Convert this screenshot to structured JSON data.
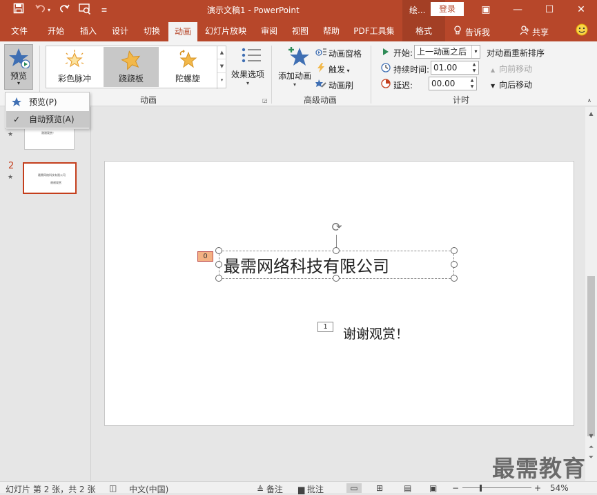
{
  "app": {
    "title": "演示文稿1  -  PowerPoint",
    "draw_label": "绘...",
    "login": "登录"
  },
  "quick_access": {
    "icons": [
      "save-icon",
      "undo-icon",
      "redo-icon",
      "start-from-beginning-icon",
      "customize-icon"
    ]
  },
  "window_controls": {
    "ribbon_display": "▣",
    "minimize": "—",
    "maximize": "☐",
    "close": "✕"
  },
  "tabs": [
    {
      "label": "文件"
    },
    {
      "label": "开始"
    },
    {
      "label": "插入"
    },
    {
      "label": "设计"
    },
    {
      "label": "切换"
    },
    {
      "label": "动画"
    },
    {
      "label": "幻灯片放映"
    },
    {
      "label": "审阅"
    },
    {
      "label": "视图"
    },
    {
      "label": "帮助"
    },
    {
      "label": "PDF工具集"
    },
    {
      "label": "格式"
    }
  ],
  "tell_me": "告诉我",
  "share": "共享",
  "ribbon": {
    "preview": {
      "label": "预览",
      "arrow": "▾"
    },
    "animation_group": {
      "label": "动画",
      "items": [
        {
          "label": "彩色脉冲"
        },
        {
          "label": "跷跷板"
        },
        {
          "label": "陀螺旋"
        }
      ],
      "effect_options": "效果选项"
    },
    "advanced_group": {
      "label": "高级动画",
      "add_animation": "添加动画",
      "animation_pane": "动画窗格",
      "trigger": "触发",
      "animation_painter": "动画刷"
    },
    "timing_group": {
      "label": "计时",
      "start_label": "开始:",
      "start_value": "上一动画之后",
      "duration_label": "持续时间:",
      "duration_value": "01.00",
      "delay_label": "延迟:",
      "delay_value": "00.00",
      "reorder_title": "对动画重新排序",
      "move_earlier": "向前移动",
      "move_later": "向后移动"
    }
  },
  "preview_menu": {
    "items": [
      {
        "label": "预览(P)"
      },
      {
        "label": "自动预览(A)",
        "checked": "✓"
      }
    ]
  },
  "slides_pane": {
    "slides": [
      {
        "number": "1",
        "text": "谢谢观赏！"
      },
      {
        "number": "2",
        "text_line1": "最需网络科技有限公司",
        "text_line2": "谢谢观赏"
      }
    ]
  },
  "slide": {
    "title_text": "最需网络科技有限公司",
    "title_anim_tag": "0",
    "thanks_text": "谢谢观赏！",
    "thanks_anim_tag": "1"
  },
  "status": {
    "slide_info": "幻灯片 第 2 张，共 2 张",
    "language": "中文(中国)",
    "notes": "备注",
    "comments": "批注",
    "zoom": "54%"
  },
  "watermark": "最需教育",
  "colors": {
    "accent": "#b7472a",
    "selected_slide_border": "#c43e1c",
    "anim_tag_selected": "#f4b183"
  }
}
